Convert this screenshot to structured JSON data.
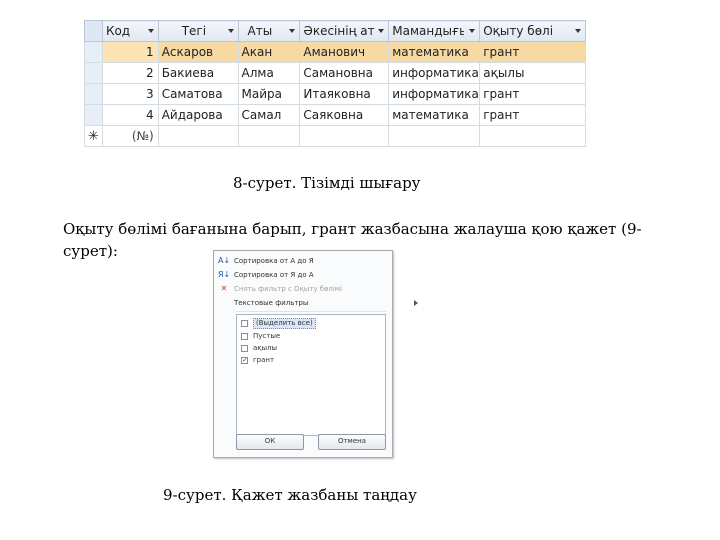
{
  "table": {
    "columns": [
      "Код",
      "Тегі",
      "Аты",
      "Әкесінің ат",
      "Мамандығы",
      "Оқыту бөлі"
    ],
    "rows": [
      [
        "1",
        "Аскаров",
        "Акан",
        "Аманович",
        "математика",
        "грант"
      ],
      [
        "2",
        "Бакиева",
        "Алма",
        "Самановна",
        "информатика",
        "ақылы"
      ],
      [
        "3",
        "Саматова",
        "Майра",
        "Итаяковна",
        "информатика",
        "грант"
      ],
      [
        "4",
        "Айдарова",
        "Самал",
        "Саяковна",
        "математика",
        "грант"
      ]
    ],
    "new_row_marker": "✳",
    "new_row_placeholder": "(№)"
  },
  "captions": {
    "figure8": "8-сурет. Тізімді шығару",
    "instruction": "Оқыту бөлімі бағанына барып, грант жазбасына жалауша қою қажет (9-сурет):",
    "figure9": "9-сурет. Қажет жазбаны таңдау"
  },
  "filter_menu": {
    "sort_asc": "Сортировка от А до Я",
    "sort_desc": "Сортировка от Я до А",
    "clear_filter": "Снять фильтр с Оқыту бөлімі",
    "text_filters": "Текстовые фильтры",
    "options": [
      {
        "label": "(Выделить все)",
        "checked": false
      },
      {
        "label": "Пустые",
        "checked": false
      },
      {
        "label": "ақылы",
        "checked": false
      },
      {
        "label": "грант",
        "checked": true
      }
    ],
    "ok": "ОК",
    "cancel": "Отмена"
  },
  "colors": {
    "selected_row": "#f7d9a3",
    "header": "#dfe7f2",
    "check": "#1e7a1e"
  }
}
